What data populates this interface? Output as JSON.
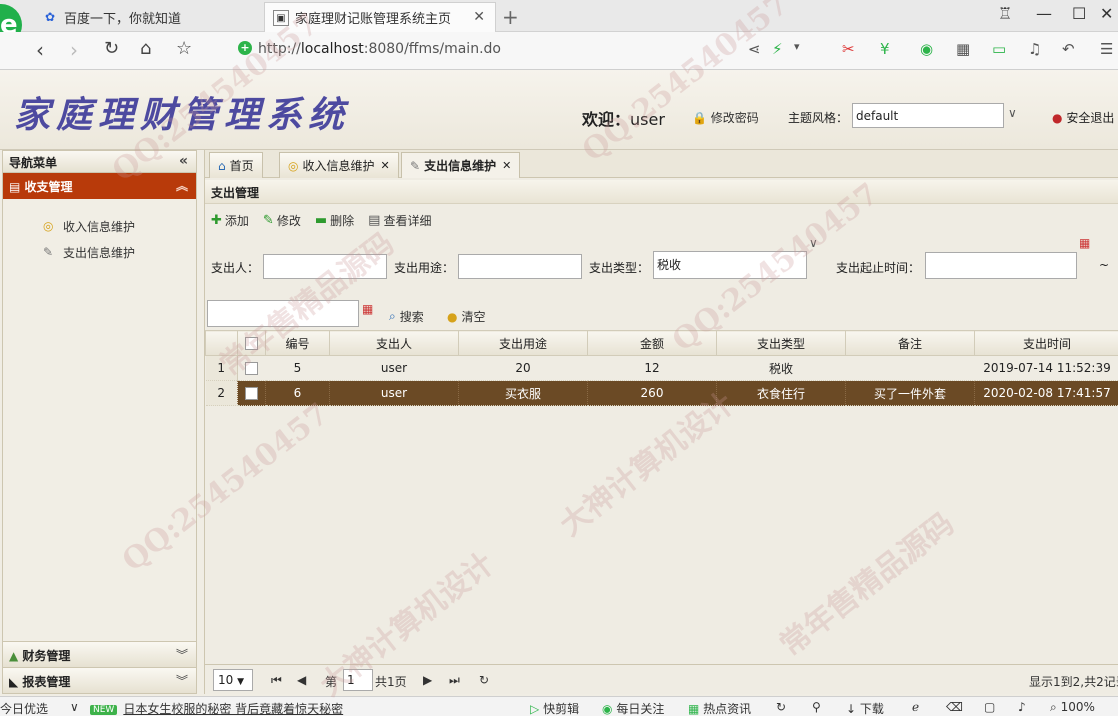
{
  "browser": {
    "tabs": [
      {
        "title": "百度一下，你就知道"
      },
      {
        "title": "家庭理财记账管理系统主页"
      }
    ],
    "url_prefix": "http://",
    "url_host": "localhost",
    "url_rest": ":8080/ffms/main.do"
  },
  "header": {
    "app_title": "家庭理财管理系统",
    "welcome_label": "欢迎：",
    "username": "user",
    "change_password": "修改密码",
    "theme_label": "主题风格：",
    "theme_value": "default",
    "logout": "安全退出"
  },
  "sidebar": {
    "title": "导航菜单",
    "group": "收支管理",
    "items": [
      {
        "label": "收入信息维护"
      },
      {
        "label": "支出信息维护"
      }
    ],
    "bottom_groups": [
      {
        "label": "财务管理"
      },
      {
        "label": "报表管理"
      }
    ]
  },
  "content_tabs": [
    {
      "label": "首页"
    },
    {
      "label": "收入信息维护"
    },
    {
      "label": "支出信息维护"
    }
  ],
  "panel": {
    "title": "支出管理",
    "toolbar": {
      "add": "添加",
      "edit": "修改",
      "delete": "删除",
      "detail": "查看详细"
    },
    "filters": {
      "payer_label": "支出人：",
      "payer_value": "",
      "purpose_label": "支出用途：",
      "purpose_value": "",
      "type_label": "支出类型：",
      "type_value": "税收",
      "time_label": "支出起止时间：",
      "time_separator": "~",
      "search": "搜索",
      "clear": "清空"
    }
  },
  "grid": {
    "columns": [
      "编号",
      "支出人",
      "支出用途",
      "金额",
      "支出类型",
      "备注",
      "支出时间"
    ],
    "rows": [
      {
        "num": "1",
        "id": "5",
        "payer": "user",
        "purpose": "20",
        "amount": "12",
        "type": "税收",
        "note": "",
        "time": "2019-07-14 11:52:39"
      },
      {
        "num": "2",
        "id": "6",
        "payer": "user",
        "purpose": "买衣服",
        "amount": "260",
        "type": "衣食住行",
        "note": "买了一件外套",
        "time": "2020-02-08 17:41:57"
      }
    ]
  },
  "pager": {
    "page_size": "10",
    "page_prefix": "第",
    "page_value": "1",
    "page_total": "共1页",
    "summary": "显示1到2,共2记录"
  },
  "statusbar": {
    "left": "今日优选",
    "new": "NEW",
    "news": "日本女生校服的秘密 背后竟藏着惊天秘密",
    "items": [
      "快剪辑",
      "每日关注",
      "热点资讯",
      "下载",
      "100%"
    ]
  },
  "watermark": [
    "QQ:254540457",
    "常年售精品源码",
    "大神计算机设计"
  ]
}
